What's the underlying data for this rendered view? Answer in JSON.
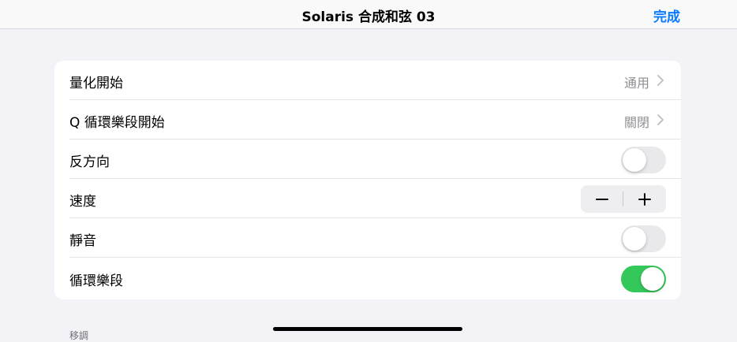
{
  "nav": {
    "title": "Solaris 合成和弦 03",
    "done_label": "完成"
  },
  "settings": {
    "quantize_start": {
      "label": "量化開始",
      "value": "通用"
    },
    "q_loop_start": {
      "label": "Q 循環樂段開始",
      "value": "關閉"
    },
    "reverse": {
      "label": "反方向",
      "state": "off"
    },
    "speed": {
      "label": "速度",
      "minus": "−",
      "plus": "+"
    },
    "mute": {
      "label": "靜音",
      "state": "off"
    },
    "loop": {
      "label": "循環樂段",
      "state": "on"
    }
  },
  "section": {
    "next_label": "移調"
  },
  "colors": {
    "accent": "#0a7aff",
    "toggle_on": "#34c759",
    "toggle_off": "#e9e9eb"
  }
}
